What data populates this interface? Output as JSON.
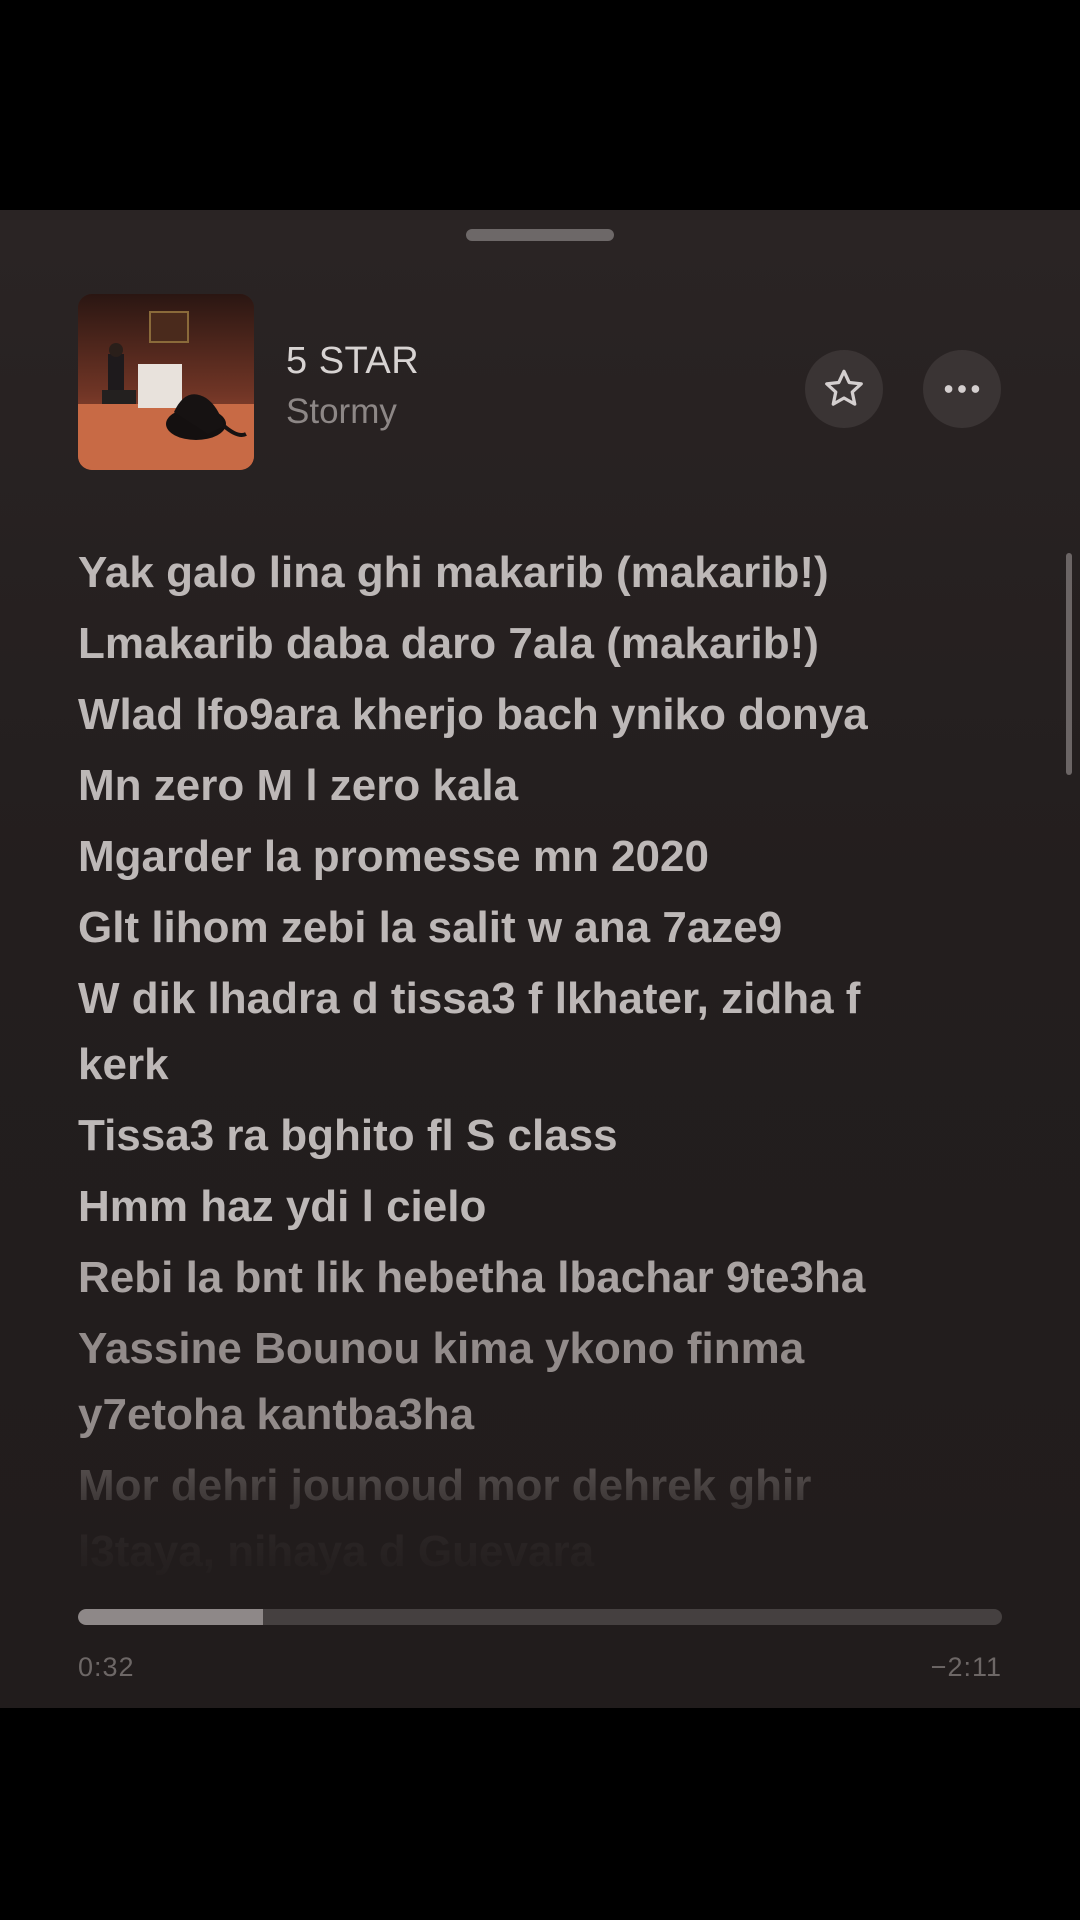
{
  "track": {
    "title": "5 STAR",
    "artist": "Stormy"
  },
  "actions": {
    "favorite_icon": "star-outline-icon",
    "more_icon": "ellipsis-icon"
  },
  "lyrics": [
    "Yak galo lina ghi makarib (makarib!)",
    "Lmakarib daba daro 7ala (makarib!)",
    "Wlad lfo9ara kherjo bach yniko donya",
    "Mn zero M l zero kala",
    "Mgarder la promesse mn 2020",
    "Glt lihom zebi la salit w ana 7aze9",
    "W dik lhadra d tissa3 f lkhater, zidha f kerk",
    "Tissa3 ra bghito fl S class",
    "Hmm haz ydi l cielo",
    "Rebi la bnt lik hebetha lbachar 9te3ha",
    "Yassine Bounou kima ykono finma y7etoha kantba3ha",
    "Mor dehri jounoud mor dehrek ghir l3taya, nihaya d Guevara"
  ],
  "playback": {
    "elapsed": "0:32",
    "remaining": "−2:11",
    "progress_fraction": 0.2
  },
  "colors": {
    "sheet_background": "#231e1e",
    "lyric_active": "#bdb8b7",
    "progress_fill": "#8e8888",
    "progress_track": "#454040"
  }
}
